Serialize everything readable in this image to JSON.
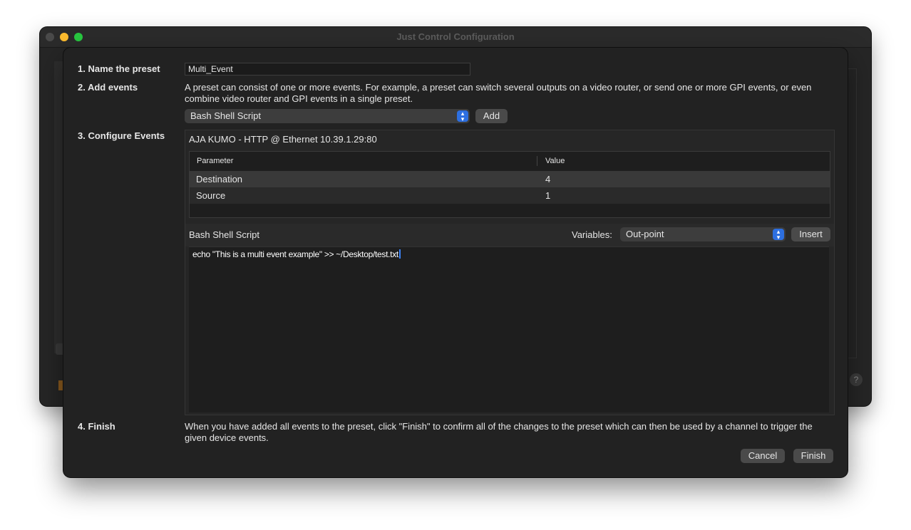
{
  "window": {
    "title": "Just Control Configuration",
    "help_label": "?"
  },
  "steps": {
    "name_label": "1. Name the preset",
    "add_label": "2. Add events",
    "configure_label": "3. Configure Events",
    "finish_label": "4. Finish"
  },
  "preset": {
    "name_value": "Multi_Event"
  },
  "add_events": {
    "description": "A preset can consist of one or more events. For example, a preset can switch several outputs on a video router, or send one or more GPI events, or even combine video router and GPI events in a single preset.",
    "event_type_selected": "Bash Shell Script",
    "add_button": "Add"
  },
  "configure": {
    "device_title": "AJA KUMO - HTTP @ Ethernet 10.39.1.29:80",
    "table": {
      "headers": [
        "Parameter",
        "Value"
      ],
      "rows": [
        {
          "parameter": "Destination",
          "value": "4"
        },
        {
          "parameter": "Source",
          "value": "1"
        }
      ]
    },
    "script": {
      "label": "Bash Shell Script",
      "variables_label": "Variables:",
      "variables_selected": "Out-point",
      "insert_button": "Insert",
      "content": "echo \"This is a multi event example\" >> ~/Desktop/test.txt"
    }
  },
  "finish": {
    "description": "When you have added all events to the preset, click \"Finish\" to confirm all of the changes to the preset which can then be used by a channel to trigger the given device events.",
    "cancel_button": "Cancel",
    "finish_button": "Finish"
  },
  "colors": {
    "accent": "#2d6fe0",
    "sheet_bg": "#222222",
    "selected_row": "#393939"
  }
}
